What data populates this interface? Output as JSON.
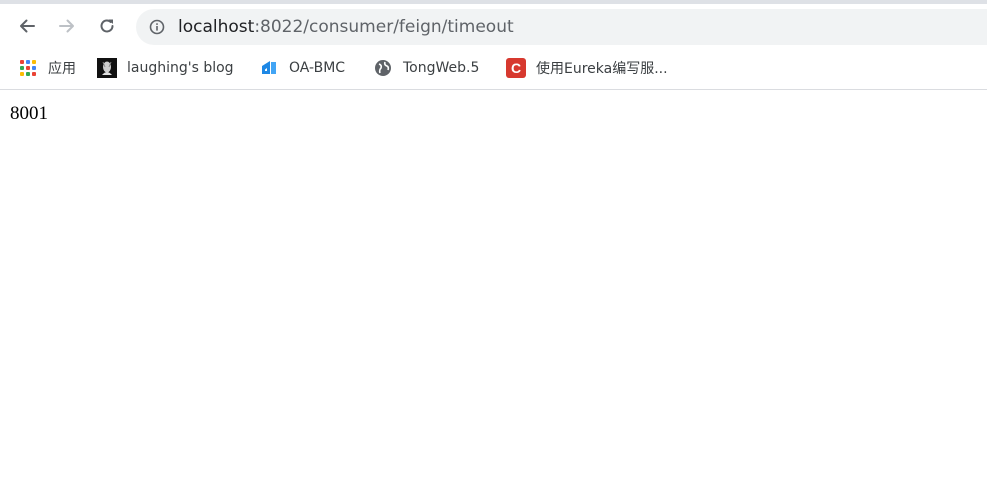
{
  "browser": {
    "address_bar": {
      "url_host": "localhost",
      "url_path": ":8022/consumer/feign/timeout"
    },
    "bookmarks": [
      {
        "label": "应用",
        "icon": "apps-grid-icon"
      },
      {
        "label": "laughing's blog",
        "icon": "blog-favicon"
      },
      {
        "label": "OA-BMC",
        "icon": "oa-bmc-favicon"
      },
      {
        "label": "TongWeb.5",
        "icon": "globe-icon"
      },
      {
        "label": "使用Eureka编写服...",
        "icon": "csdn-favicon"
      }
    ],
    "colors": {
      "omnibox_bg": "#f1f3f4",
      "csdn_red": "#d7392f",
      "oa_blue": "#1e88e5"
    }
  },
  "page": {
    "body_text": "8001"
  }
}
